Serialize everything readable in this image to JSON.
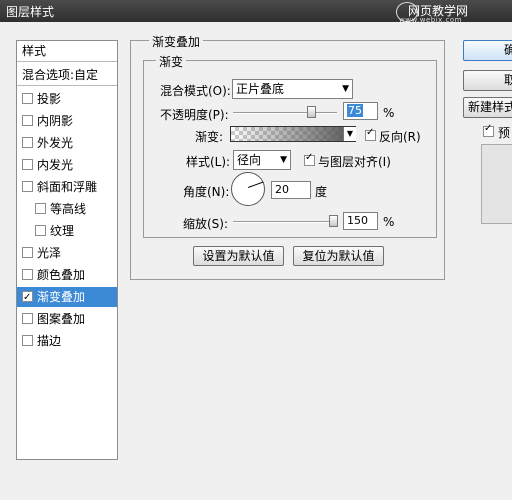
{
  "window": {
    "title": "图层样式",
    "watermark": "网页教学网",
    "watermark_sub": "www.webjx.com"
  },
  "left_panel": {
    "header": "样式",
    "blend_options": "混合选项:自定",
    "items": [
      {
        "label": "投影",
        "checked": false
      },
      {
        "label": "内阴影",
        "checked": false
      },
      {
        "label": "外发光",
        "checked": false
      },
      {
        "label": "内发光",
        "checked": false
      },
      {
        "label": "斜面和浮雕",
        "checked": false
      },
      {
        "label": "等高线",
        "checked": false
      },
      {
        "label": "纹理",
        "checked": false
      },
      {
        "label": "光泽",
        "checked": false
      },
      {
        "label": "颜色叠加",
        "checked": false
      },
      {
        "label": "渐变叠加",
        "checked": true,
        "selected": true
      },
      {
        "label": "图案叠加",
        "checked": false
      },
      {
        "label": "描边",
        "checked": false
      }
    ]
  },
  "gradient_overlay": {
    "section_title": "渐变叠加",
    "group_title": "渐变",
    "blend_mode_label": "混合模式(O):",
    "blend_mode_value": "正片叠底",
    "opacity_label": "不透明度(P):",
    "opacity_value": "75",
    "opacity_percent": 0.75,
    "percent_unit": "%",
    "gradient_label": "渐变:",
    "reverse_label": "反向(R)",
    "reverse_checked": true,
    "style_label": "样式(L):",
    "style_value": "径向",
    "align_label": "与图层对齐(I)",
    "align_checked": true,
    "angle_label": "角度(N):",
    "angle_value": "20",
    "angle_unit": "度",
    "scale_label": "缩放(S):",
    "scale_value": "150",
    "scale_fraction": 1.0,
    "set_default_button": "设置为默认值",
    "reset_default_button": "复位为默认值"
  },
  "right_panel": {
    "ok_label": "确",
    "cancel_label": "取",
    "new_style_label": "新建样式",
    "preview_label": "预",
    "preview_checked": true
  },
  "colors": {
    "accent": "#3c8ad6",
    "titlebar": "#3a3a3a"
  }
}
